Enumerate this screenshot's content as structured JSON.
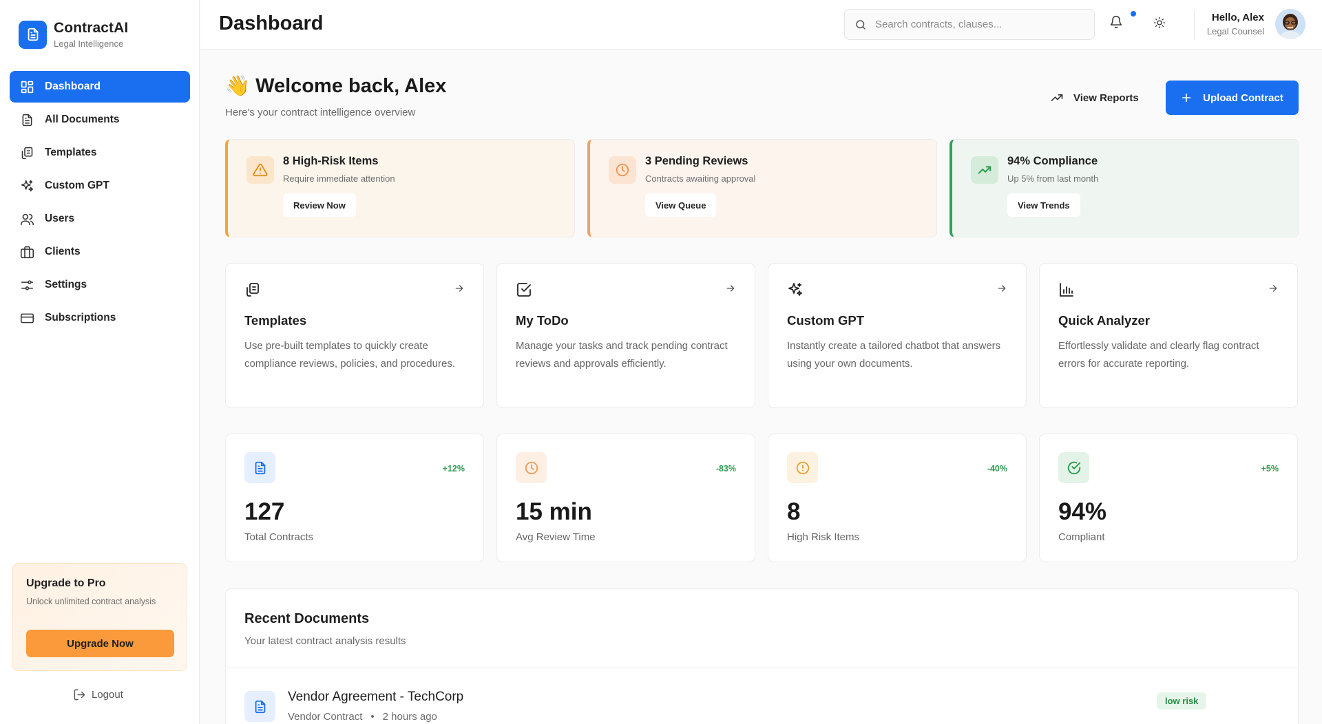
{
  "brand": {
    "name": "ContractAI",
    "tagline": "Legal Intelligence"
  },
  "sidebar": {
    "items": [
      {
        "label": "Dashboard",
        "icon": "dashboard-icon",
        "active": true
      },
      {
        "label": "All Documents",
        "icon": "document-icon"
      },
      {
        "label": "Templates",
        "icon": "copy-icon"
      },
      {
        "label": "Custom GPT",
        "icon": "sparkle-icon"
      },
      {
        "label": "Users",
        "icon": "users-icon"
      },
      {
        "label": "Clients",
        "icon": "briefcase-icon"
      },
      {
        "label": "Settings",
        "icon": "sliders-icon"
      },
      {
        "label": "Subscriptions",
        "icon": "credit-card-icon"
      }
    ],
    "upgrade": {
      "title": "Upgrade to Pro",
      "desc": "Unlock unlimited contract analysis",
      "button": "Upgrade Now"
    },
    "logout": "Logout"
  },
  "header": {
    "title": "Dashboard",
    "search_placeholder": "Search contracts, clauses...",
    "user_name": "Hello, Alex",
    "user_role": "Legal Counsel"
  },
  "welcome": {
    "emoji": "👋",
    "title": "Welcome back, Alex",
    "subtitle": "Here's your contract intelligence overview",
    "reports_button": "View Reports",
    "upload_button": "Upload Contract"
  },
  "alerts": [
    {
      "title": "8 High-Risk Items",
      "desc": "Require immediate attention",
      "button": "Review Now",
      "color": "#f3a53a"
    },
    {
      "title": "3 Pending Reviews",
      "desc": "Contracts awaiting approval",
      "button": "View Queue",
      "color": "#f3a05e"
    },
    {
      "title": "94% Compliance",
      "desc": "Up 5% from last month",
      "button": "View Trends",
      "color": "#2fa356"
    }
  ],
  "features": [
    {
      "title": "Templates",
      "desc": "Use pre-built templates to quickly create compliance reviews, policies, and procedures."
    },
    {
      "title": "My ToDo",
      "desc": "Manage your tasks and track pending contract reviews and approvals efficiently."
    },
    {
      "title": "Custom GPT",
      "desc": "Instantly create a tailored chatbot that answers using your own documents."
    },
    {
      "title": "Quick Analyzer",
      "desc": "Effortlessly validate and clearly flag contract errors for accurate reporting."
    }
  ],
  "stats": [
    {
      "value": "127",
      "label": "Total Contracts",
      "change": "+12%"
    },
    {
      "value": "15 min",
      "label": "Avg Review Time",
      "change": "-83%"
    },
    {
      "value": "8",
      "label": "High Risk Items",
      "change": "-40%"
    },
    {
      "value": "94%",
      "label": "Compliant",
      "change": "+5%"
    }
  ],
  "recent": {
    "title": "Recent Documents",
    "subtitle": "Your latest contract analysis results",
    "rows": [
      {
        "name": "Vendor Agreement - TechCorp",
        "type": "Vendor Contract",
        "time": "2 hours ago",
        "risk": "low risk"
      }
    ]
  }
}
